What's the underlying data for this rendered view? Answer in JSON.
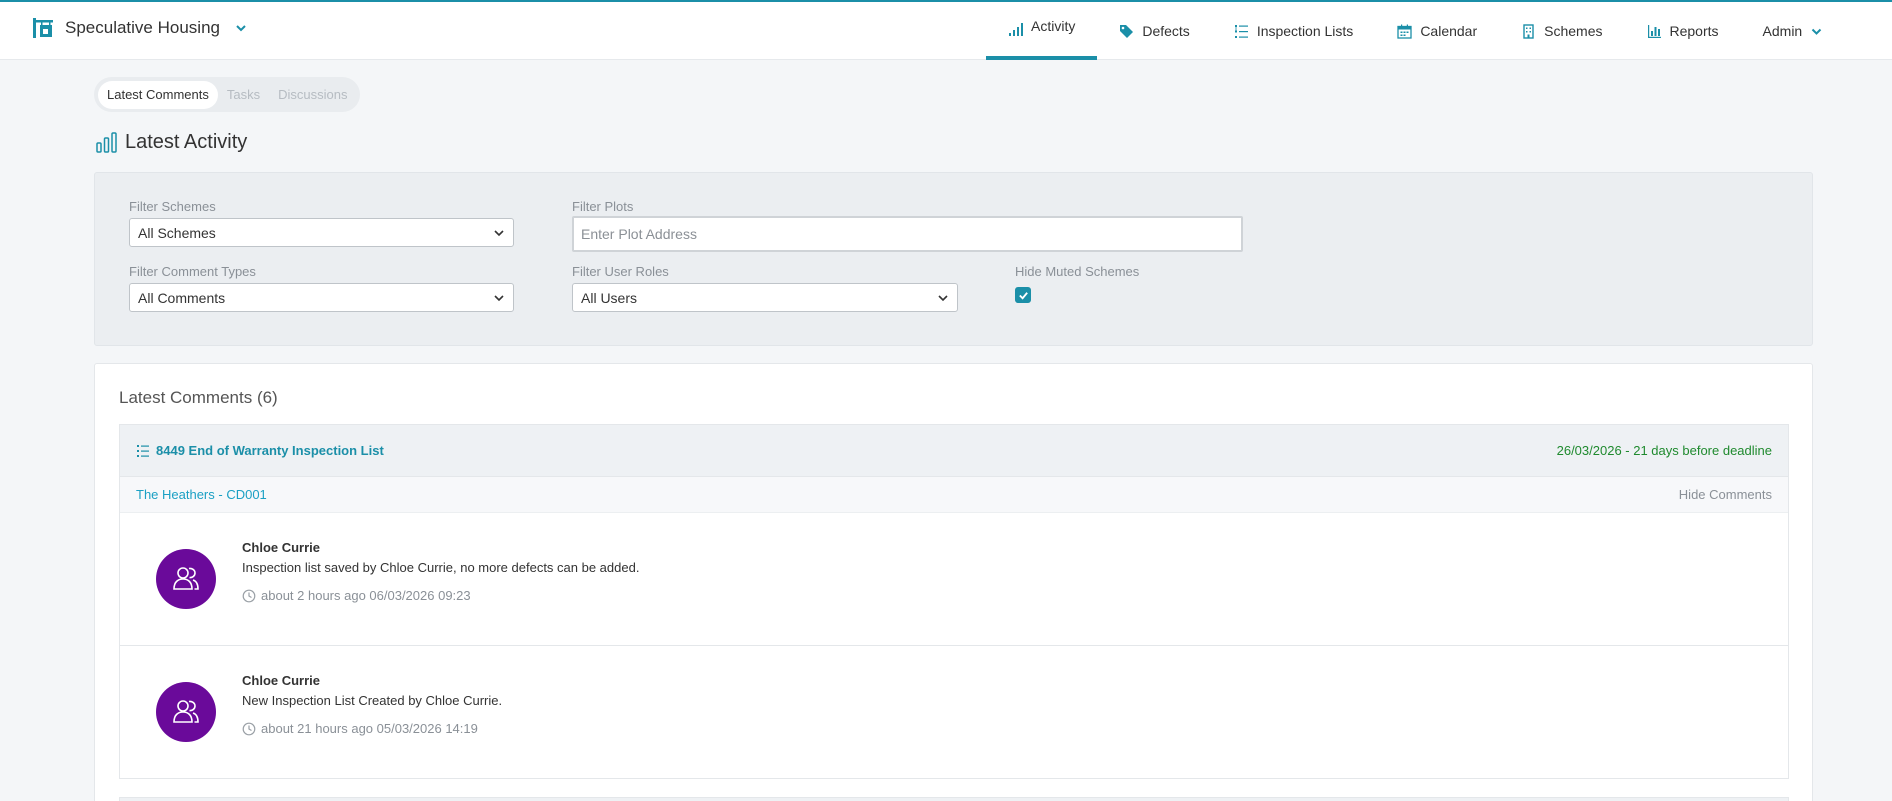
{
  "app": {
    "name": "Speculative Housing"
  },
  "nav": {
    "items": [
      {
        "label": "Activity",
        "icon": "bar-chart-icon",
        "active": true
      },
      {
        "label": "Defects",
        "icon": "tag-icon"
      },
      {
        "label": "Inspection Lists",
        "icon": "list-icon"
      },
      {
        "label": "Calendar",
        "icon": "calendar-icon"
      },
      {
        "label": "Schemes",
        "icon": "building-icon"
      },
      {
        "label": "Reports",
        "icon": "chart-icon"
      },
      {
        "label": "Admin",
        "icon": "chevron-down-icon"
      }
    ]
  },
  "tabs": [
    {
      "label": "Latest Comments",
      "active": true
    },
    {
      "label": "Tasks"
    },
    {
      "label": "Discussions"
    }
  ],
  "page": {
    "title": "Latest Activity"
  },
  "filters": {
    "schemes": {
      "label": "Filter Schemes",
      "value": "All Schemes"
    },
    "plots": {
      "label": "Filter Plots",
      "placeholder": "Enter Plot Address"
    },
    "comment_types": {
      "label": "Filter Comment Types",
      "value": "All Comments"
    },
    "user_roles": {
      "label": "Filter User Roles",
      "value": "All Users"
    },
    "hide_muted": {
      "label": "Hide Muted Schemes",
      "checked": true
    }
  },
  "comments_section": {
    "title": "Latest Comments (6)",
    "list": {
      "title": "8449 End of Warranty Inspection List",
      "deadline": "26/03/2026 - 21 days before deadline",
      "plot": "The Heathers - CD001",
      "hide_label": "Hide Comments",
      "comments": [
        {
          "author": "Chloe Currie",
          "text": "Inspection list saved by Chloe Currie, no more defects can be added.",
          "time": "about 2 hours ago 06/03/2026 09:23"
        },
        {
          "author": "Chloe Currie",
          "text": "New Inspection List Created by Chloe Currie.",
          "time": "about 21 hours ago 05/03/2026 14:19"
        }
      ]
    }
  },
  "colors": {
    "accent": "#1b8fa8",
    "avatar": "#6a0a9a",
    "deadline": "#1f8a2e",
    "link": "#1ba0c4"
  }
}
